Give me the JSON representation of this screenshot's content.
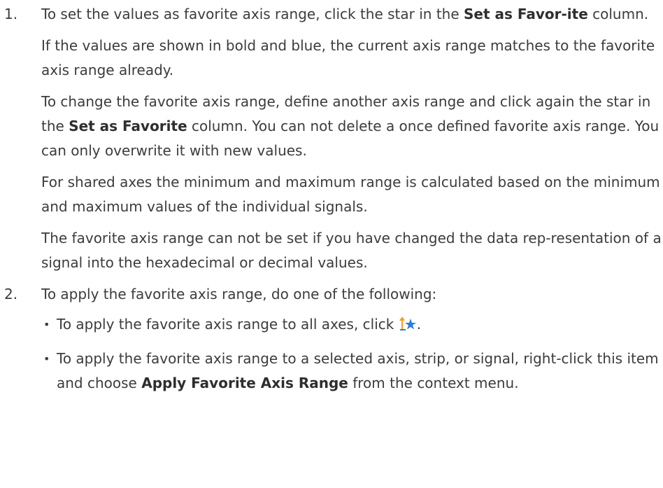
{
  "steps": [
    {
      "number": "1.",
      "paragraphs": {
        "p1_pre": "To set the values as favorite axis range, click the star in the ",
        "p1_bold": "Set as Favor-ite",
        "p1_post": " column.",
        "p2": "If the values are shown in bold and blue, the current axis range matches to the favorite axis range already.",
        "p3_pre": "To change the favorite axis range, define another axis range and click again the star in the ",
        "p3_bold": "Set as Favorite",
        "p3_post": " column. You can not delete a once defined favorite axis range. You can only overwrite it with new values.",
        "p4": "For shared axes the minimum and maximum range is calculated based on the minimum and maximum values of the individual signals.",
        "p5": "The favorite axis range can not be set if you have changed the data rep-resentation of a signal into the hexadecimal or decimal values."
      }
    },
    {
      "number": "2.",
      "intro": "To apply the favorite axis range, do one of the following:",
      "bullets": {
        "b1_pre": "To apply the favorite axis range to all axes, click ",
        "b1_post": ".",
        "b1_icon": "apply-favorite-axis-range-icon",
        "b2_pre": "To apply the favorite axis range to a selected axis, strip, or signal, right-click this item and choose ",
        "b2_bold": "Apply Favorite Axis Range",
        "b2_post": " from the context menu."
      }
    }
  ],
  "bullet_glyph": "•",
  "colors": {
    "text": "#3c3c3c",
    "icon_star": "#2a7de1",
    "icon_arrow": "#f0a020"
  }
}
